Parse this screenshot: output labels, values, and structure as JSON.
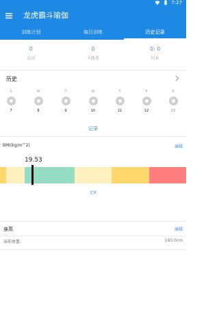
{
  "status_bar": {
    "time": "7:27",
    "wifi_icon": "wifi-icon",
    "battery_icon": "battery-icon"
  },
  "app_bar": {
    "title": "龙虎霸斗瑜伽",
    "menu_icon": "menu-icon"
  },
  "tabs": [
    {
      "label": "训练计划",
      "active": false
    },
    {
      "label": "每日训练",
      "active": false
    },
    {
      "label": "历史记录",
      "active": true
    }
  ],
  "stats": [
    {
      "value": "0",
      "label": "运动"
    },
    {
      "value": "0",
      "label": "卡路里"
    },
    {
      "value": "0: 0",
      "label": "时长"
    }
  ],
  "history": {
    "title": "历史",
    "chevron_icon": "chevron-right-icon",
    "days": [
      {
        "letter": "S",
        "date": "7"
      },
      {
        "letter": "M",
        "date": "8"
      },
      {
        "letter": "T",
        "date": "9"
      },
      {
        "letter": "W",
        "date": "10"
      },
      {
        "letter": "T",
        "date": "11"
      },
      {
        "letter": "F",
        "date": "12"
      },
      {
        "letter": "S",
        "date": "13"
      }
    ],
    "record_link": "记录"
  },
  "bmi": {
    "title": "BMI(kg/m^2)",
    "edit_label": "编辑",
    "value": "19.53",
    "status": "正常",
    "colors": {
      "segment_1": "#ffd76b",
      "segment_2": "#fff1bf",
      "segment_3": "#96dcc3",
      "segment_4": "#fff1bf",
      "segment_5": "#ffd76b",
      "segment_6": "#ff7f7f"
    }
  },
  "height": {
    "title": "身高",
    "edit_label": "编辑",
    "label": "当前体重:",
    "value": "160.0cm"
  },
  "colors": {
    "primary": "#1e88e5",
    "accent": "#5a96d6"
  }
}
